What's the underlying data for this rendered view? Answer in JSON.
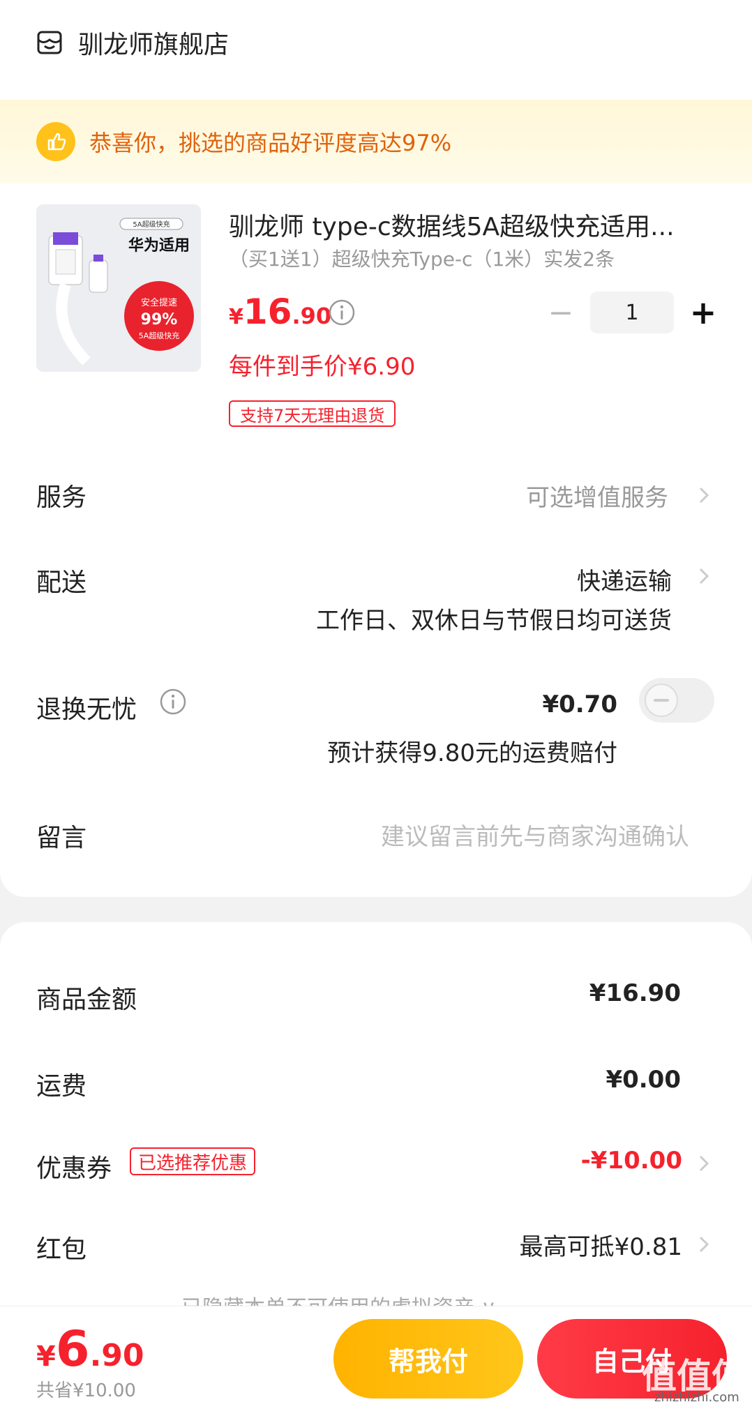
{
  "shop": {
    "name": "驯龙师旗舰店",
    "icon": "shop-icon"
  },
  "banner": {
    "text": "恭喜你，挑选的商品好评度高达97%",
    "icon": "thumbs-up-icon"
  },
  "product": {
    "image_heading": "华为适用",
    "image_tag": "5A超级快充",
    "image_badge_line1": "安全提速",
    "image_badge_line2": "99%",
    "image_badge_line3": "5A超级快充",
    "title": "驯龙师 type-c数据线5A超级快充适用...",
    "sku": "（买1送1）超级快充Type-c（1米）实发2条",
    "price_currency": "¥",
    "price_int": "16",
    "price_dec": ".90",
    "quantity": "1",
    "final_price": "每件到手价¥6.90",
    "return_policy": "支持7天无理由退货"
  },
  "service": {
    "label": "服务",
    "value": "可选增值服务"
  },
  "delivery": {
    "label": "配送",
    "method": "快递运输",
    "note": "工作日、双休日与节假日均可送货"
  },
  "return_insurance": {
    "label": "退换无忧",
    "price": "¥0.70",
    "note": "预计获得9.80元的运费赔付",
    "enabled": false
  },
  "message": {
    "label": "留言",
    "placeholder": "建议留言前先与商家沟通确认"
  },
  "summary": {
    "goods_label": "商品金额",
    "goods_value": "¥16.90",
    "shipping_label": "运费",
    "shipping_value": "¥0.00",
    "coupon_label": "优惠券",
    "coupon_badge": "已选推荐优惠",
    "coupon_value": "-¥10.00",
    "redpacket_label": "红包",
    "redpacket_value": "最高可抵¥0.81",
    "hidden_note": "已隐藏本单不可使用的虚拟资产 ∨"
  },
  "footer": {
    "total_currency": "¥",
    "total_int": "6",
    "total_dec": ".90",
    "saved": "共省¥10.00",
    "help_pay": "帮我付",
    "self_pay": "自己付",
    "watermark": "值值值",
    "watermark_sub": "zhizhizhi.com"
  },
  "colors": {
    "accent_red": "#f5222d",
    "accent_yellow": "#ffc21a",
    "banner_text": "#e0620d"
  }
}
